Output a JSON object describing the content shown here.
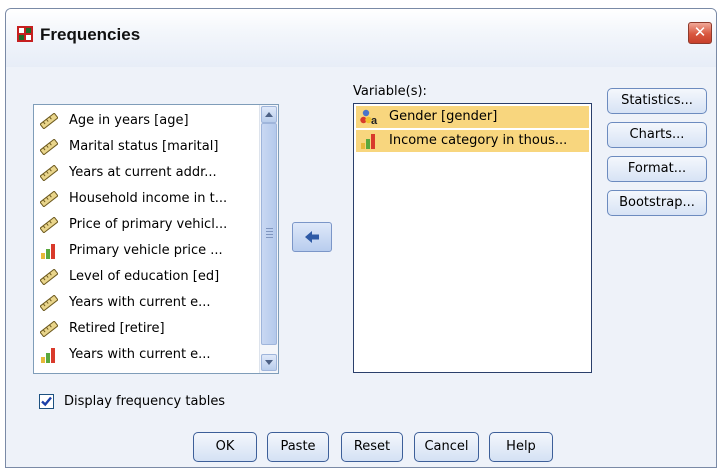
{
  "window": {
    "title": "Frequencies",
    "close_glyph": "✕"
  },
  "source": {
    "items": [
      {
        "label": "Age in years [age]",
        "icon": "scale-ruler-icon"
      },
      {
        "label": "Marital status [marital]",
        "icon": "scale-ruler-icon"
      },
      {
        "label": "Years at current addr...",
        "icon": "scale-ruler-icon"
      },
      {
        "label": "Household income in t...",
        "icon": "scale-ruler-icon"
      },
      {
        "label": "Price of primary vehicl...",
        "icon": "scale-ruler-icon"
      },
      {
        "label": "Primary vehicle price ...",
        "icon": "ordinal-bars-icon"
      },
      {
        "label": "Level of education [ed]",
        "icon": "scale-ruler-icon"
      },
      {
        "label": "Years with current e...",
        "icon": "scale-ruler-icon"
      },
      {
        "label": "Retired [retire]",
        "icon": "scale-ruler-icon"
      },
      {
        "label": "Years with current e...",
        "icon": "ordinal-bars-icon"
      }
    ]
  },
  "target": {
    "label": "Variable(s):",
    "items": [
      {
        "label": "Gender [gender]",
        "icon": "nominal-string-icon"
      },
      {
        "label": "Income category in thous...",
        "icon": "ordinal-bars-icon"
      }
    ]
  },
  "side_buttons": [
    "Statistics...",
    "Charts...",
    "Format...",
    "Bootstrap..."
  ],
  "checkbox": {
    "label": "Display frequency tables",
    "checked": true
  },
  "bottom_buttons": [
    "OK",
    "Paste",
    "Reset",
    "Cancel",
    "Help"
  ],
  "colors": {
    "selection": "#f8d67e",
    "accent": "#3d5f99"
  }
}
